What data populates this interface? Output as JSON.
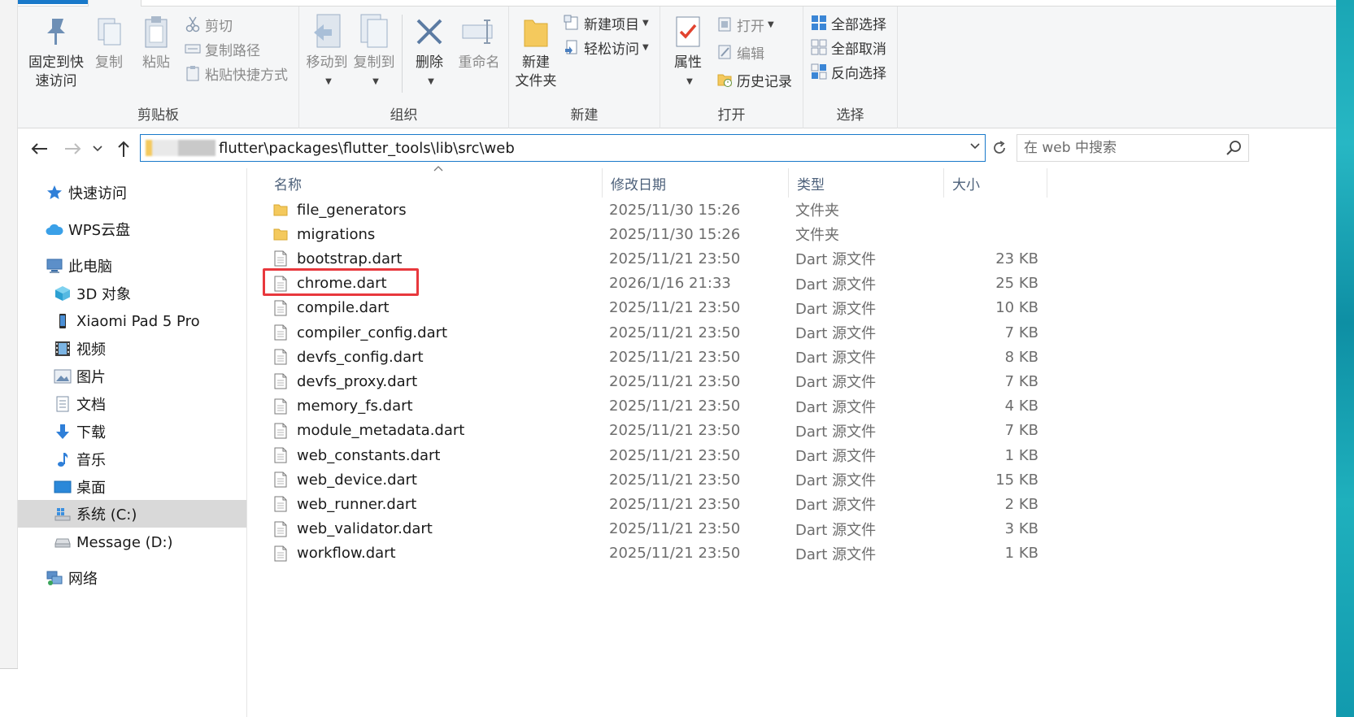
{
  "ribbon": {
    "clipboard": {
      "pin_label": "固定到快\n速访问",
      "copy_label": "复制",
      "paste_label": "粘贴",
      "cut_label": "剪切",
      "copy_path_label": "复制路径",
      "paste_shortcut_label": "粘贴快捷方式",
      "group_label": "剪贴板"
    },
    "organize": {
      "move_to_label": "移动到",
      "copy_to_label": "复制到",
      "delete_label": "删除",
      "rename_label": "重命名",
      "group_label": "组织"
    },
    "new": {
      "new_folder_label": "新建\n文件夹",
      "new_item_label": "新建项目",
      "easy_access_label": "轻松访问",
      "group_label": "新建"
    },
    "open": {
      "properties_label": "属性",
      "open_label": "打开",
      "edit_label": "编辑",
      "history_label": "历史记录",
      "group_label": "打开"
    },
    "select": {
      "select_all_label": "全部选择",
      "select_none_label": "全部取消",
      "invert_label": "反向选择",
      "group_label": "选择"
    }
  },
  "address": {
    "path": "flutter\\packages\\flutter_tools\\lib\\src\\web"
  },
  "search": {
    "placeholder": "在 web 中搜索"
  },
  "nav": {
    "quick_access": "快速访问",
    "wps_cloud": "WPS云盘",
    "this_pc": "此电脑",
    "objects_3d": "3D 对象",
    "xiaomi_pad": "Xiaomi Pad 5 Pro",
    "videos": "视频",
    "pictures": "图片",
    "documents": "文档",
    "downloads": "下载",
    "music": "音乐",
    "desktop": "桌面",
    "system_c": "系统 (C:)",
    "message_d": "Message (D:)",
    "network": "网络"
  },
  "columns": {
    "name": "名称",
    "date": "修改日期",
    "type": "类型",
    "size": "大小"
  },
  "files": [
    {
      "name": "file_generators",
      "date": "2025/11/30 15:26",
      "type": "文件夹",
      "size": "",
      "kind": "folder"
    },
    {
      "name": "migrations",
      "date": "2025/11/30 15:26",
      "type": "文件夹",
      "size": "",
      "kind": "folder"
    },
    {
      "name": "bootstrap.dart",
      "date": "2025/11/21 23:50",
      "type": "Dart 源文件",
      "size": "23 KB",
      "kind": "file"
    },
    {
      "name": "chrome.dart",
      "date": "2026/1/16 21:33",
      "type": "Dart 源文件",
      "size": "25 KB",
      "kind": "file"
    },
    {
      "name": "compile.dart",
      "date": "2025/11/21 23:50",
      "type": "Dart 源文件",
      "size": "10 KB",
      "kind": "file"
    },
    {
      "name": "compiler_config.dart",
      "date": "2025/11/21 23:50",
      "type": "Dart 源文件",
      "size": "7 KB",
      "kind": "file"
    },
    {
      "name": "devfs_config.dart",
      "date": "2025/11/21 23:50",
      "type": "Dart 源文件",
      "size": "8 KB",
      "kind": "file"
    },
    {
      "name": "devfs_proxy.dart",
      "date": "2025/11/21 23:50",
      "type": "Dart 源文件",
      "size": "7 KB",
      "kind": "file"
    },
    {
      "name": "memory_fs.dart",
      "date": "2025/11/21 23:50",
      "type": "Dart 源文件",
      "size": "4 KB",
      "kind": "file"
    },
    {
      "name": "module_metadata.dart",
      "date": "2025/11/21 23:50",
      "type": "Dart 源文件",
      "size": "7 KB",
      "kind": "file"
    },
    {
      "name": "web_constants.dart",
      "date": "2025/11/21 23:50",
      "type": "Dart 源文件",
      "size": "1 KB",
      "kind": "file"
    },
    {
      "name": "web_device.dart",
      "date": "2025/11/21 23:50",
      "type": "Dart 源文件",
      "size": "15 KB",
      "kind": "file"
    },
    {
      "name": "web_runner.dart",
      "date": "2025/11/21 23:50",
      "type": "Dart 源文件",
      "size": "2 KB",
      "kind": "file"
    },
    {
      "name": "web_validator.dart",
      "date": "2025/11/21 23:50",
      "type": "Dart 源文件",
      "size": "3 KB",
      "kind": "file"
    },
    {
      "name": "workflow.dart",
      "date": "2025/11/21 23:50",
      "type": "Dart 源文件",
      "size": "1 KB",
      "kind": "file"
    }
  ],
  "colors": {
    "accent": "#1979ca",
    "highlight_box": "#e8383d",
    "folder": "#f4c95d",
    "selected_nav": "#d9d9d9"
  }
}
